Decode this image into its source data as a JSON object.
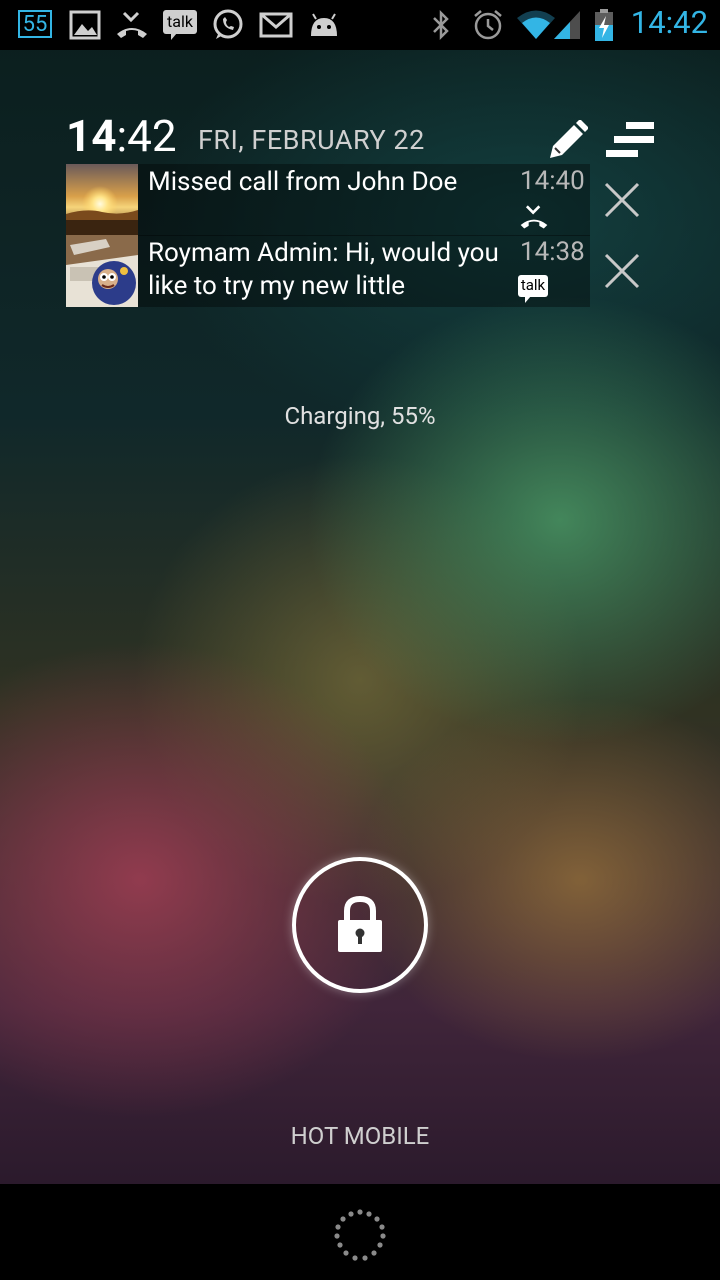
{
  "status_bar": {
    "badge": "55",
    "time": "14:42",
    "left_icons": [
      "image-icon",
      "missed-call-icon",
      "talk-icon",
      "whatsapp-icon",
      "gmail-icon",
      "android-icon"
    ],
    "talk_label": "talk",
    "right_icons": [
      "bluetooth-icon",
      "alarm-icon",
      "wifi-icon",
      "signal-icon",
      "battery-charging-icon"
    ],
    "accent_color": "#33b5e5"
  },
  "lockscreen": {
    "clock_hour": "14",
    "clock_minutes": ":42",
    "date": "FRI, FEBRUARY 22",
    "charging": "Charging, 55%",
    "carrier": "HOT MOBILE"
  },
  "notifications": [
    {
      "text": "Missed call from John Doe",
      "time": "14:40",
      "icon": "missed-call-icon"
    },
    {
      "text": "Roymam Admin: Hi, would you like to try my new little",
      "time": "14:38",
      "icon": "talk-icon",
      "icon_label": "talk"
    }
  ]
}
